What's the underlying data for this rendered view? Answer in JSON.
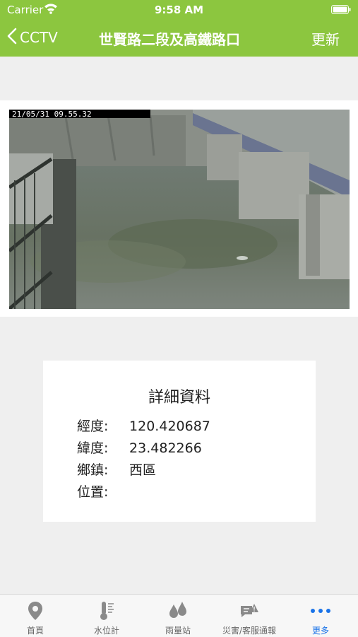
{
  "status_bar": {
    "carrier": "Carrier",
    "time": "9:58 AM"
  },
  "nav": {
    "back_label": "CCTV",
    "title": "世賢路二段及高鐵路口",
    "refresh_label": "更新"
  },
  "camera": {
    "timestamp": "21/05/31  09.55.32"
  },
  "details": {
    "title": "詳細資料",
    "rows": [
      {
        "label": "經度:",
        "value": "120.420687"
      },
      {
        "label": "緯度:",
        "value": "23.482266"
      },
      {
        "label": "鄉鎮:",
        "value": "西區"
      },
      {
        "label": "位置:",
        "value": ""
      }
    ]
  },
  "tabs": [
    {
      "label": "首頁",
      "icon": "map-pin-icon"
    },
    {
      "label": "水位計",
      "icon": "thermometer-icon"
    },
    {
      "label": "雨量站",
      "icon": "raindrops-icon"
    },
    {
      "label": "災害/客服通報",
      "icon": "report-chat-icon"
    },
    {
      "label": "更多",
      "icon": "more-dots-icon",
      "active": true
    }
  ],
  "colors": {
    "brand_green": "#8cc63f",
    "active_tab": "#1a73e8",
    "inactive_tab": "#8a8a8a"
  }
}
